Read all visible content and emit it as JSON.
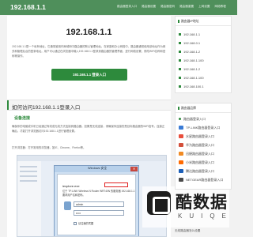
{
  "header": {
    "site_title": "192.168.1.1",
    "nav": [
      "路由器登录入口",
      "路由器设置",
      "路由器密码",
      "路由器重置",
      "上网设置",
      "网络教程"
    ]
  },
  "main": {
    "ip_title": "192.168.1.1",
    "intro": "192.168.1.1是一个私有地址，它通常被用作局域网中路由器的默认管理地址。在家庭和办公网络中，路由器通常使用该地址作为网关和管理后台的登录地址。用户可以通过在浏览器中输入192.168.1.1登录到路由器的管理界面，进行网络设置、修改WiFi名称和密码等操作。",
    "login_button": "192.168.1.1 登录入口",
    "section_title": "如何访问192.168.1.1登录入口",
    "sub_head": "设备连接",
    "para1": "确保你的电脑或手机已经通过有线或无线方式连接到路由器。如果是无线连接，请确保你连接的是目标路由器的WiFi信号。连接正确后，才能打开浏览器访问192.168.1.1进行管理设置。",
    "para2": "打开浏览器：打开常用的浏览器，如IE、Chrome、Firefox等。",
    "screenshot": {
      "window_title": "Windows 安全",
      "line1": "iexplore.exe",
      "line2": "位于 TP-LINK Wireless N Router WR740N 的服务器 192.168.1.1 要求用户名和密码。",
      "username": "admin",
      "password": "•••••",
      "remember": "记住我的凭据",
      "close_glyph": "✕"
    },
    "watermark": {
      "main": "酷数据",
      "sub": "KUIQE"
    }
  },
  "sidebar": {
    "login_card": {
      "title": "路由器IP地址",
      "items": [
        "192.168.1.1",
        "192.168.0.1",
        "192.168.1.2",
        "192.168.1.100",
        "192.168.1.2",
        "192.168.1.100",
        "192.168.100.1"
      ]
    },
    "brand_card": {
      "title": "路由器品牌",
      "items": [
        "路由器登录入口",
        "TP-LINK路由器登录入口",
        "水星路由器登录入口",
        "华为路由器登录入口",
        "迅捷路由器登录入口",
        "小米路由器登录入口",
        "腾达路由器登录入口",
        "NETGEAR路由器登录入口"
      ],
      "thumb_colors": [
        "#3a7bd5",
        "#e94e3c",
        "#2d8a3c",
        "#d34f3a",
        "#f08a24",
        "#ff6a00",
        "#1c5fb8",
        "#4a4a4a"
      ]
    },
    "bottom_text": "无线路由器怎么设置"
  }
}
